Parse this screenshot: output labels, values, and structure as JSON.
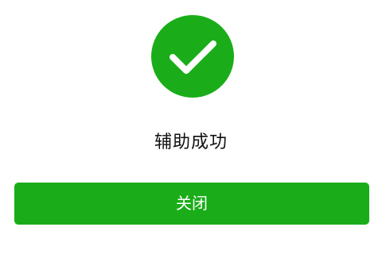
{
  "result": {
    "icon": "checkmark-icon",
    "status_text": "辅助成功"
  },
  "actions": {
    "close_label": "关闭"
  },
  "colors": {
    "accent": "#1aad19",
    "background": "#ffffff",
    "text": "#111111",
    "button_text": "#ffffff"
  }
}
